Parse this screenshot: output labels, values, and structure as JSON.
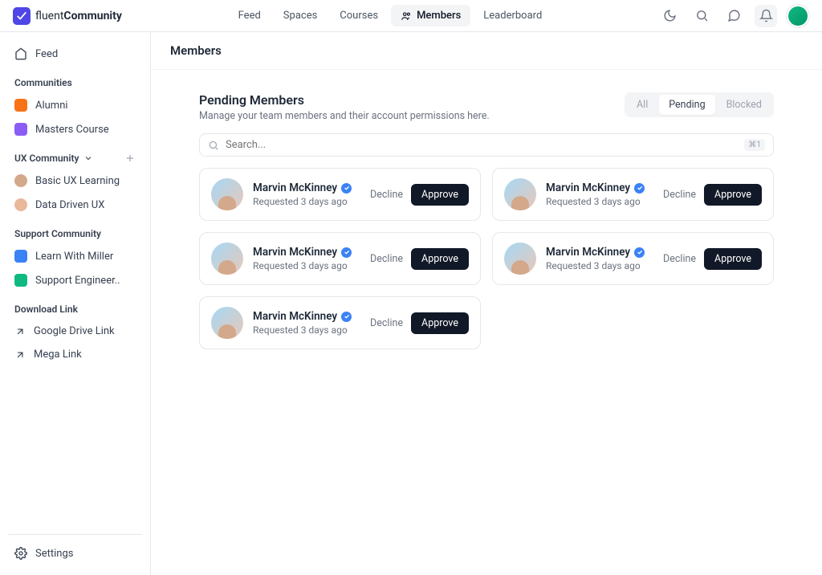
{
  "brand": {
    "name1": "fluent",
    "name2": "Community"
  },
  "topnav": {
    "items": [
      {
        "label": "Feed"
      },
      {
        "label": "Spaces"
      },
      {
        "label": "Courses"
      },
      {
        "label": "Members",
        "active": true
      },
      {
        "label": "Leaderboard"
      }
    ]
  },
  "sidebar": {
    "feed": "Feed",
    "communities_label": "Communities",
    "communities": [
      {
        "label": "Alumni",
        "color": "#f97316"
      },
      {
        "label": "Masters Course",
        "color": "#8b5cf6"
      }
    ],
    "ux_label": "UX Community",
    "ux": [
      {
        "label": "Basic UX Learning",
        "avatar": "#d4a88a"
      },
      {
        "label": "Data Driven UX",
        "avatar": "#e8b89a"
      }
    ],
    "support_label": "Support Community",
    "support": [
      {
        "label": "Learn With Miller",
        "color": "#3b82f6"
      },
      {
        "label": "Support Engineer..",
        "color": "#10b981"
      }
    ],
    "download_label": "Download Link",
    "download": [
      {
        "label": "Google Drive Link"
      },
      {
        "label": "Mega Link"
      }
    ],
    "settings": "Settings"
  },
  "page": {
    "title": "Members",
    "section_title": "Pending Members",
    "section_sub": "Manage your team members and their account permissions here.",
    "segments": {
      "all": "All",
      "pending": "Pending",
      "blocked": "Blocked"
    },
    "search_placeholder": "Search...",
    "kbd": "⌘1",
    "decline": "Decline",
    "approve": "Approve"
  },
  "members": [
    {
      "name": "Marvin McKinney",
      "meta": "Requested 3 days ago"
    },
    {
      "name": "Marvin McKinney",
      "meta": "Requested 3 days ago"
    },
    {
      "name": "Marvin McKinney",
      "meta": "Requested 3 days ago"
    },
    {
      "name": "Marvin McKinney",
      "meta": "Requested 3 days ago"
    },
    {
      "name": "Marvin McKinney",
      "meta": "Requested 3 days ago"
    }
  ]
}
